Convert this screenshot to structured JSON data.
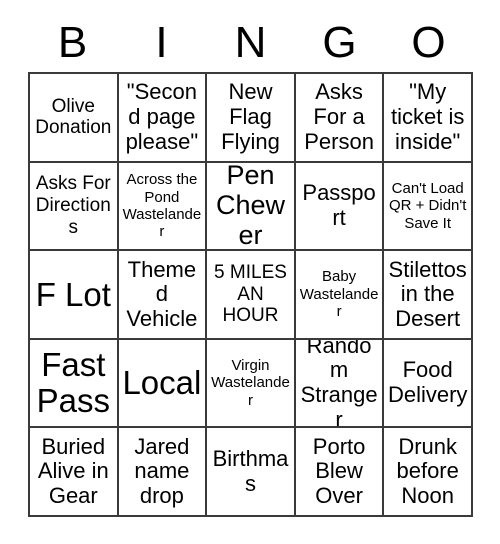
{
  "card": {
    "header_letters": [
      "B",
      "I",
      "N",
      "G",
      "O"
    ],
    "rows": [
      [
        {
          "text": "Olive Donation",
          "size": "md"
        },
        {
          "text": "\"Second page please\"",
          "size": "lg"
        },
        {
          "text": "New Flag Flying",
          "size": "lg"
        },
        {
          "text": "Asks For a Person",
          "size": "lg"
        },
        {
          "text": "\"My ticket is inside\"",
          "size": "lg"
        }
      ],
      [
        {
          "text": "Asks For Directions",
          "size": "md"
        },
        {
          "text": "Across the Pond Wastelander",
          "size": "sm"
        },
        {
          "text": "Pen Chewer",
          "size": "xl"
        },
        {
          "text": "Passport",
          "size": "lg"
        },
        {
          "text": "Can't Load QR + Didn't Save It",
          "size": "sm"
        }
      ],
      [
        {
          "text": "F Lot",
          "size": "xxl"
        },
        {
          "text": "Themed Vehicle",
          "size": "lg"
        },
        {
          "text": "5 MILES AN HOUR",
          "size": "md"
        },
        {
          "text": "Baby Wastelander",
          "size": "sm"
        },
        {
          "text": "Stilettos in the Desert",
          "size": "lg"
        }
      ],
      [
        {
          "text": "Fast Pass",
          "size": "xxl"
        },
        {
          "text": "Local",
          "size": "xxl"
        },
        {
          "text": "Virgin Wastelander",
          "size": "sm"
        },
        {
          "text": "Random Stranger",
          "size": "lg"
        },
        {
          "text": "Food Delivery",
          "size": "lg"
        }
      ],
      [
        {
          "text": "Buried Alive in Gear",
          "size": "lg"
        },
        {
          "text": "Jared name drop",
          "size": "lg"
        },
        {
          "text": "Birthmas",
          "size": "lg"
        },
        {
          "text": "Porto Blew Over",
          "size": "lg"
        },
        {
          "text": "Drunk before Noon",
          "size": "lg"
        }
      ]
    ]
  },
  "colors": {
    "background": "#ffffff",
    "grid_line": "#3a3a3a",
    "text": "#000000"
  }
}
